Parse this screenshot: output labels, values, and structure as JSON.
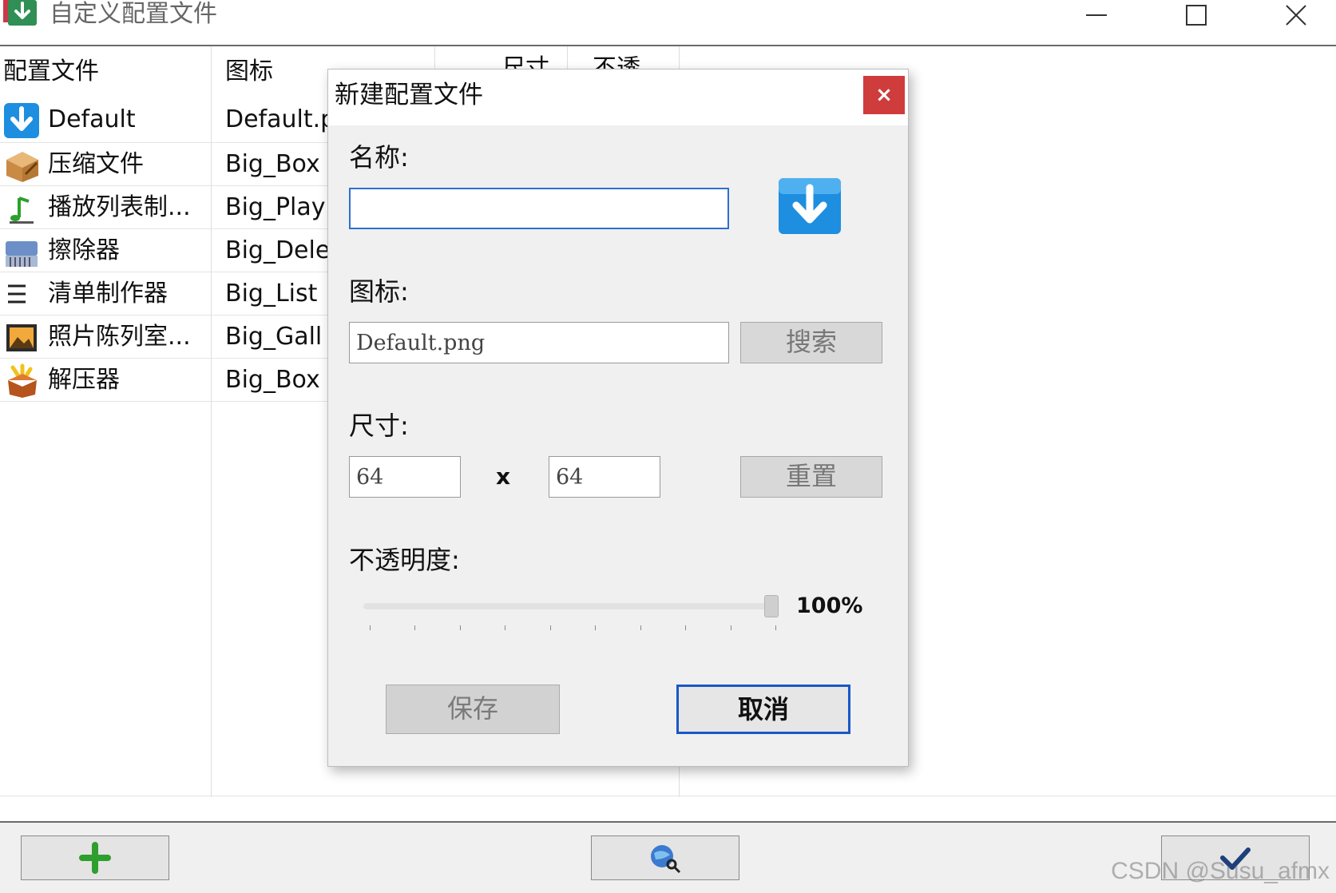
{
  "window": {
    "title": "自定义配置文件"
  },
  "list": {
    "headers": [
      "配置文件",
      "图标",
      "尺寸",
      "不透"
    ],
    "rows": [
      {
        "name": "Default",
        "icon_file": "Default.png",
        "icon": "download-arrow-icon"
      },
      {
        "name": "压缩文件",
        "icon_file": "Big_Box",
        "icon": "box-icon"
      },
      {
        "name": "播放列表制...",
        "icon_file": "Big_Play",
        "icon": "music-note-icon"
      },
      {
        "name": "擦除器",
        "icon_file": "Big_Dele",
        "icon": "shredder-icon"
      },
      {
        "name": "清单制作器",
        "icon_file": "Big_List",
        "icon": "list-icon"
      },
      {
        "name": "照片陈列室...",
        "icon_file": "Big_Gall",
        "icon": "photo-icon"
      },
      {
        "name": "解压器",
        "icon_file": "Big_Box",
        "icon": "open-box-icon"
      }
    ]
  },
  "dialog": {
    "title": "新建配置文件",
    "close_label": "×",
    "name_label": "名称:",
    "name_value": "",
    "icon_label": "图标:",
    "icon_value": "Default.png",
    "browse_label": "搜索",
    "size_label": "尺寸:",
    "width_value": "64",
    "x_label": "x",
    "height_value": "64",
    "reset_label": "重置",
    "opacity_label": "不透明度:",
    "opacity_value": 1.0,
    "opacity_text": "100%",
    "save_label": "保存",
    "cancel_label": "取消"
  },
  "bottom": {
    "watermark": "CSDN @Susu_afmx"
  },
  "colors": {
    "accent": "#1a57c7",
    "close": "#cf3c3c",
    "add": "#2e9e2e"
  }
}
